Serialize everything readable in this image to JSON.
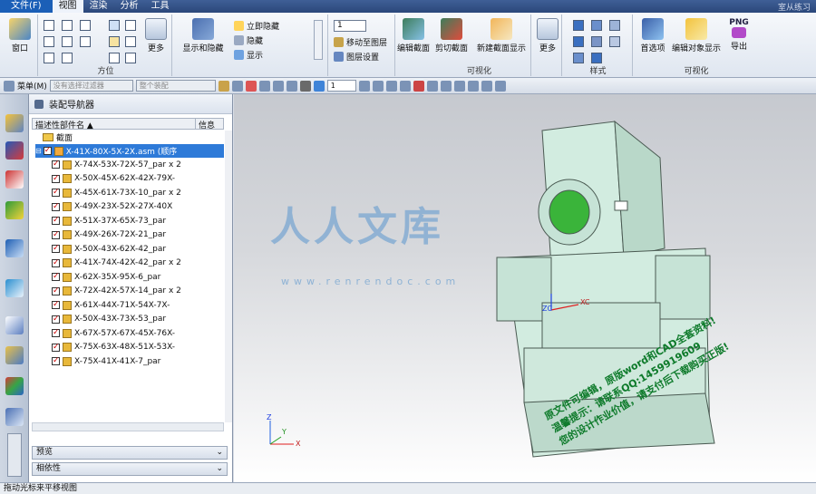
{
  "menubar": {
    "file": "文件(F)",
    "items": [
      "视图",
      "渲染",
      "分析",
      "工具"
    ],
    "app_title": "室从练习"
  },
  "ribbon": {
    "groups": [
      "方位",
      "可视化",
      "样式",
      "可视化"
    ],
    "window_btn": "窗口",
    "more_btn": "更多",
    "show_hide_btn": "显示和隐藏",
    "show_options": [
      "立即隐藏",
      "隐藏",
      "显示"
    ],
    "layer_value": "1",
    "move_layer": "移动至图层",
    "layer_settings": "图层设置",
    "edit_section": "编辑截面",
    "clip_section": "剪切截面",
    "new_section": "新建截面显示",
    "more2": "更多",
    "prefs": "首选项",
    "edit_display": "编辑对象显示",
    "export": "导出",
    "png": "PNG"
  },
  "toolbar2": {
    "menu": "菜单(M)",
    "filter": "没有选择过滤器",
    "scope": "整个装配",
    "layer": "1"
  },
  "navigator": {
    "title": "装配导航器",
    "col_name": "描述性部件名",
    "col_info": "信息",
    "section_node": "截面",
    "root": "X-41X-80X-5X-2X.asm (顺序",
    "parts": [
      "X-74X-53X-72X-57_par x 2",
      "X-50X-45X-62X-42X-79X-",
      "X-45X-61X-73X-10_par x 2",
      "X-49X-23X-52X-27X-40X",
      "X-51X-37X-65X-73_par",
      "X-49X-26X-72X-21_par",
      "X-50X-43X-62X-42_par",
      "X-41X-74X-42X-42_par x 2",
      "X-62X-35X-95X-6_par",
      "X-72X-42X-57X-14_par x 2",
      "X-61X-44X-71X-54X-7X-",
      "X-50X-43X-73X-53_par",
      "X-67X-57X-67X-45X-76X-",
      "X-75X-63X-48X-51X-53X-",
      "X-75X-41X-41X-7_par"
    ],
    "preview": "预览",
    "dependency": "相依性"
  },
  "viewport": {
    "axis_xc": "XC",
    "axis_zc": "ZC",
    "triad_x": "X",
    "triad_y": "Y",
    "triad_z": "Z",
    "watermark_big": "人人文库",
    "watermark_url": "www.renrendoc.com",
    "promo_lines": [
      "原文件可编辑，原版word和CAD全套资料!",
      "温馨提示：请联系QQ:1459919609",
      "您的设计作业价值，请支付后下载购买正版!"
    ]
  },
  "status": "拖动光标来平移视图"
}
